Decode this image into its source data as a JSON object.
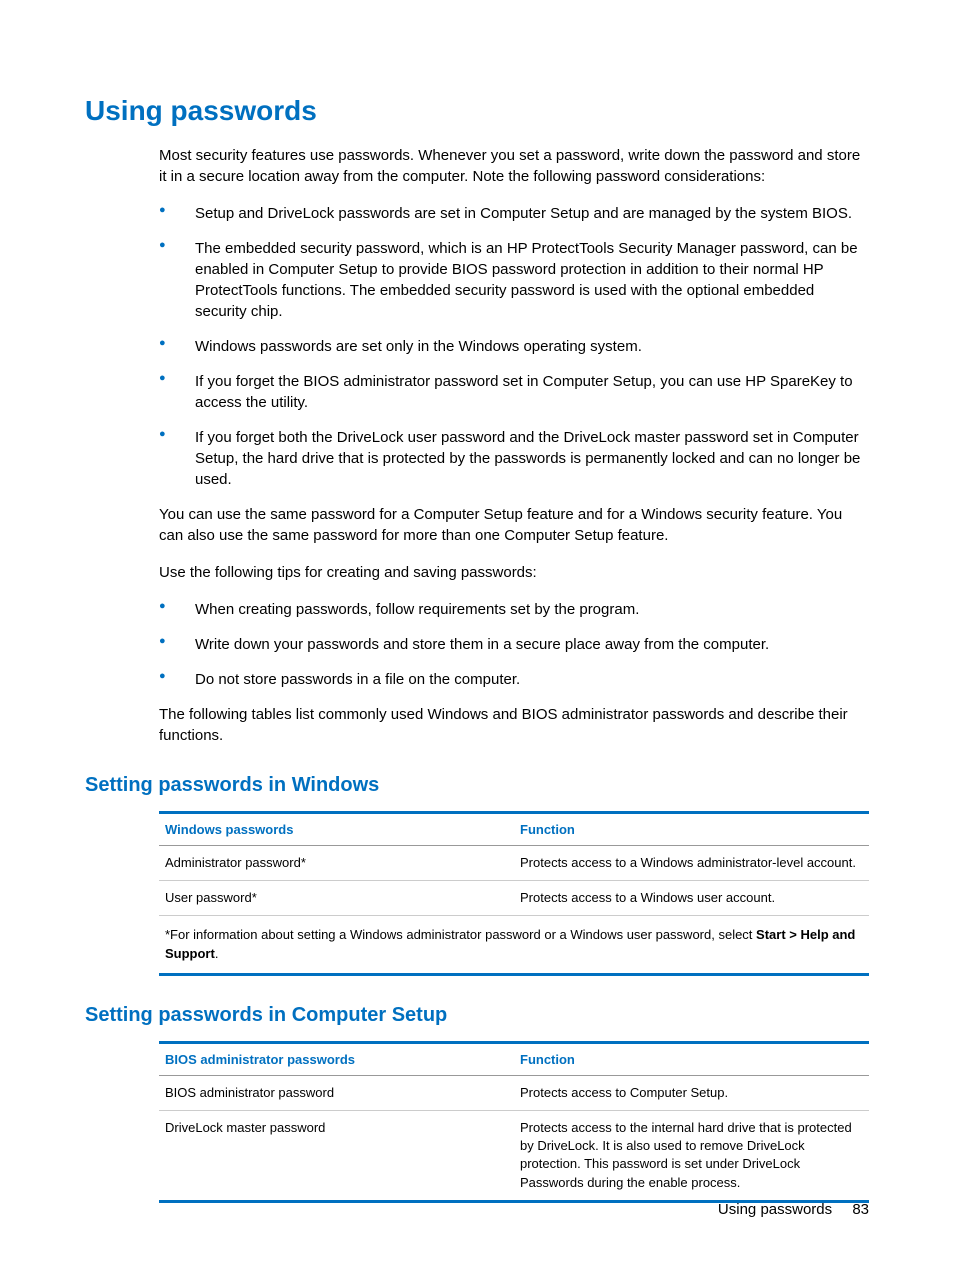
{
  "heading": "Using passwords",
  "intro": "Most security features use passwords. Whenever you set a password, write down the password and store it in a secure location away from the computer. Note the following password considerations:",
  "bullets1": [
    "Setup and DriveLock passwords are set in Computer Setup and are managed by the system BIOS.",
    "The embedded security password, which is an HP ProtectTools Security Manager password, can be enabled in Computer Setup to provide BIOS password protection in addition to their normal HP ProtectTools functions. The embedded security password is used with the optional embedded security chip.",
    "Windows passwords are set only in the Windows operating system.",
    "If you forget the BIOS administrator password set in Computer Setup, you can use HP SpareKey to access the utility.",
    "If you forget both the DriveLock user password and the DriveLock master password set in Computer Setup, the hard drive that is protected by the passwords is permanently locked and can no longer be used."
  ],
  "para2": "You can use the same password for a Computer Setup feature and for a Windows security feature. You can also use the same password for more than one Computer Setup feature.",
  "para3": "Use the following tips for creating and saving passwords:",
  "bullets2": [
    "When creating passwords, follow requirements set by the program.",
    "Write down your passwords and store them in a secure place away from the computer.",
    "Do not store passwords in a file on the computer."
  ],
  "para4": "The following tables list commonly used Windows and BIOS administrator passwords and describe their functions.",
  "section1": {
    "heading": "Setting passwords in Windows",
    "col1": "Windows passwords",
    "col2": "Function",
    "rows": [
      {
        "c1": "Administrator password*",
        "c2": "Protects access to a Windows administrator-level account."
      },
      {
        "c1": "User password*",
        "c2": "Protects access to a Windows user account."
      }
    ],
    "footnote_pre": "*For information about setting a Windows administrator password or a Windows user password, select ",
    "footnote_bold": "Start > Help and Support",
    "footnote_post": "."
  },
  "section2": {
    "heading": "Setting passwords in Computer Setup",
    "col1": "BIOS administrator passwords",
    "col2": "Function",
    "rows": [
      {
        "c1": "BIOS administrator password",
        "c2": "Protects access to Computer Setup."
      },
      {
        "c1": "DriveLock master password",
        "c2": "Protects access to the internal hard drive that is protected by DriveLock. It is also used to remove DriveLock protection. This password is set under DriveLock Passwords during the enable process."
      }
    ]
  },
  "footer": {
    "label": "Using passwords",
    "page": "83"
  }
}
